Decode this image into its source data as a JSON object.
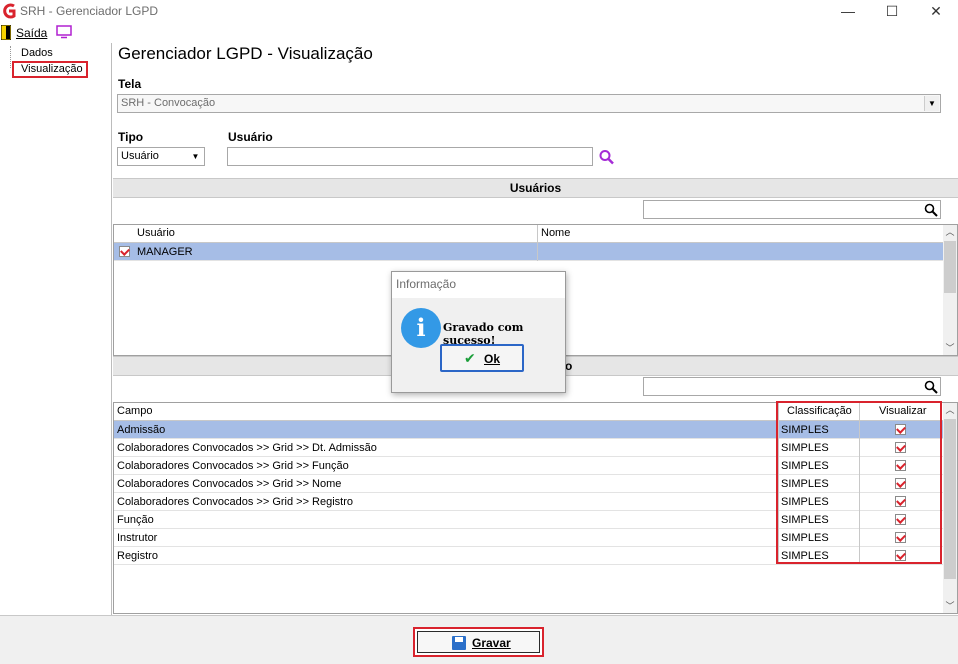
{
  "window": {
    "title": "SRH - Gerenciador LGPD",
    "minimize": "—",
    "maximize": "☐",
    "close": "✕"
  },
  "menu": {
    "exit_label": "Saída"
  },
  "tree": {
    "items": [
      "Dados",
      "Visualização"
    ]
  },
  "page_title": "Gerenciador LGPD - Visualização",
  "tela": {
    "label": "Tela",
    "value": "SRH - Convocação"
  },
  "tipo": {
    "label": "Tipo",
    "value": "Usuário"
  },
  "usuario": {
    "label": "Usuário",
    "value": ""
  },
  "users_section": {
    "title": "Usuários",
    "search_value": "",
    "columns": [
      "Usuário",
      "Nome"
    ],
    "rows": [
      {
        "usuario": "MANAGER",
        "nome": "",
        "checked": true
      }
    ]
  },
  "fields_section": {
    "title_fragment": "o",
    "search_value": "",
    "columns": [
      "Campo",
      "Classificação",
      "Visualizar"
    ],
    "rows": [
      {
        "campo": "Admissão",
        "classificacao": "SIMPLES",
        "visualizar": true
      },
      {
        "campo": "Colaboradores Convocados >> Grid >> Dt. Admissão",
        "classificacao": "SIMPLES",
        "visualizar": true
      },
      {
        "campo": "Colaboradores Convocados >> Grid >> Função",
        "classificacao": "SIMPLES",
        "visualizar": true
      },
      {
        "campo": "Colaboradores Convocados >> Grid >> Nome",
        "classificacao": "SIMPLES",
        "visualizar": true
      },
      {
        "campo": "Colaboradores Convocados >> Grid >> Registro",
        "classificacao": "SIMPLES",
        "visualizar": true
      },
      {
        "campo": "Função",
        "classificacao": "SIMPLES",
        "visualizar": true
      },
      {
        "campo": "Instrutor",
        "classificacao": "SIMPLES",
        "visualizar": true
      },
      {
        "campo": "Registro",
        "classificacao": "SIMPLES",
        "visualizar": true
      }
    ]
  },
  "dialog": {
    "title": "Informação",
    "message": "Gravado com sucesso!",
    "ok_label": "Ok",
    "icon": "i"
  },
  "footer": {
    "save_label": "Gravar"
  },
  "colors": {
    "accent_red": "#d9232d",
    "selection": "#a6bde6",
    "info_blue": "#3399e6"
  }
}
